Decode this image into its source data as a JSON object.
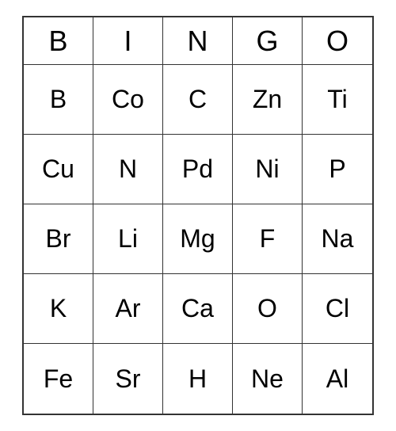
{
  "header": {
    "columns": [
      "B",
      "I",
      "N",
      "G",
      "O"
    ]
  },
  "grid": [
    [
      "B",
      "Co",
      "C",
      "Zn",
      "Ti"
    ],
    [
      "Cu",
      "N",
      "Pd",
      "Ni",
      "P"
    ],
    [
      "Br",
      "Li",
      "Mg",
      "F",
      "Na"
    ],
    [
      "K",
      "Ar",
      "Ca",
      "O",
      "Cl"
    ],
    [
      "Fe",
      "Sr",
      "H",
      "Ne",
      "Al"
    ]
  ]
}
